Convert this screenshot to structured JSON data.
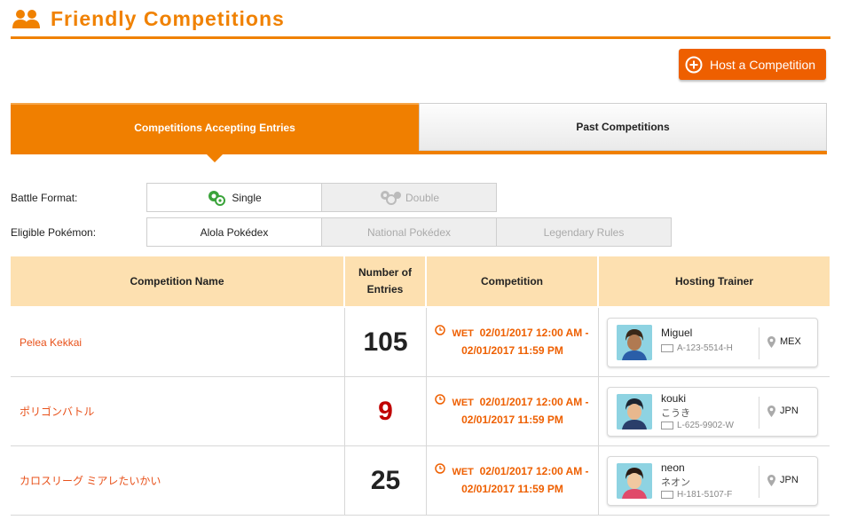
{
  "header": {
    "title": "Friendly Competitions",
    "icon": "people-icon"
  },
  "host_button": {
    "label": "Host a Competition",
    "icon": "plus-circle-icon"
  },
  "tabs": [
    {
      "label": "Competitions Accepting Entries",
      "active": true
    },
    {
      "label": "Past Competitions",
      "active": false
    }
  ],
  "filters": {
    "battle_format": {
      "label": "Battle Format:",
      "options": [
        {
          "label": "Single",
          "selected": true
        },
        {
          "label": "Double",
          "selected": false
        }
      ]
    },
    "eligible_pokemon": {
      "label": "Eligible Pokémon:",
      "options": [
        {
          "label": "Alola Pokédex",
          "selected": true
        },
        {
          "label": "National Pokédex",
          "selected": false
        },
        {
          "label": "Legendary Rules",
          "selected": false
        }
      ]
    }
  },
  "table": {
    "headers": [
      "Competition Name",
      "Number of Entries",
      "Competition",
      "Hosting Trainer"
    ],
    "rows": [
      {
        "name": "Pelea Kekkai",
        "entries": "105",
        "entries_color": "#222222",
        "tz": "WET",
        "start": "02/01/2017 12:00 AM -",
        "end": "02/01/2017 11:59 PM",
        "trainer": {
          "name": "Miguel",
          "sub": "",
          "id": "A-123-5514-H",
          "country": "MEX"
        }
      },
      {
        "name": "ポリゴンバトル",
        "entries": "9",
        "entries_color": "#c00000",
        "tz": "WET",
        "start": "02/01/2017 12:00 AM -",
        "end": "02/01/2017 11:59 PM",
        "trainer": {
          "name": "kouki",
          "sub": "こうき",
          "id": "L-625-9902-W",
          "country": "JPN"
        }
      },
      {
        "name": "カロスリーグ ミアレたいかい",
        "entries": "25",
        "entries_color": "#222222",
        "tz": "WET",
        "start": "02/01/2017 12:00 AM -",
        "end": "02/01/2017 11:59 PM",
        "trainer": {
          "name": "neon",
          "sub": "ネオン",
          "id": "H-181-5107-F",
          "country": "JPN"
        }
      }
    ]
  },
  "colors": {
    "accent": "#f08100",
    "button": "#ee5f00",
    "header_bg": "#fde0b0",
    "link": "#e8511a"
  }
}
